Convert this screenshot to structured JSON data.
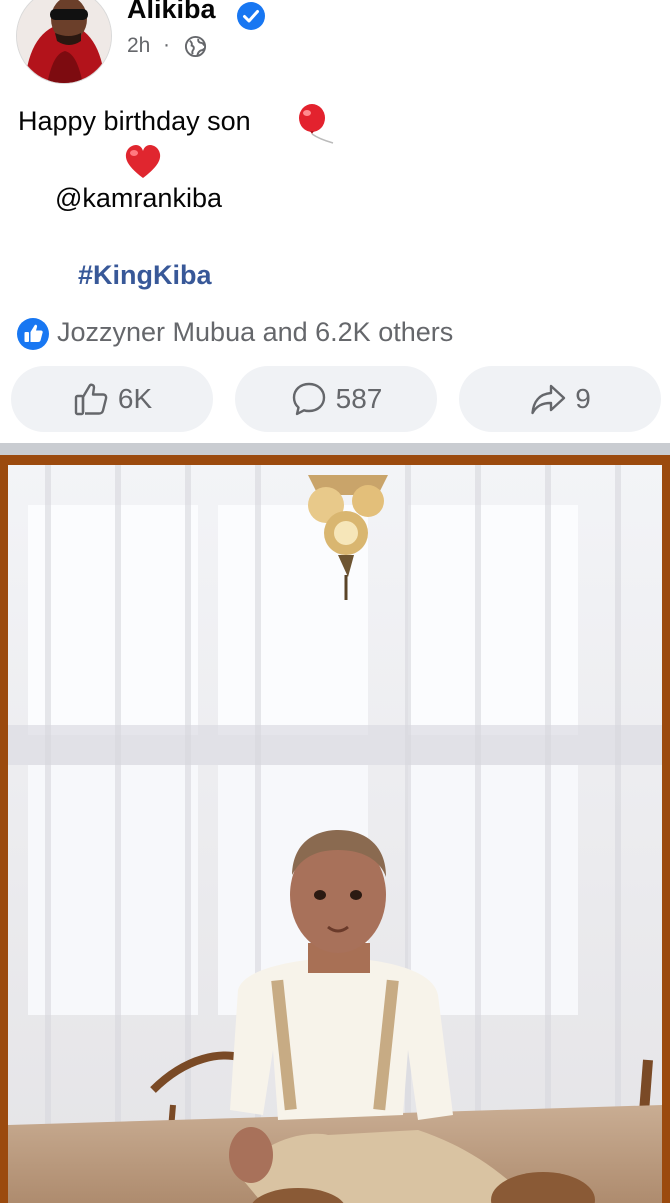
{
  "post": {
    "author": "Alikiba",
    "time": "2h",
    "separator": "·",
    "icons": {
      "verified": "verified-badge-icon",
      "audience": "globe-icon"
    },
    "text_line1": "Happy birthday son",
    "mention": "@kamrankiba",
    "hashtag": "#KingKiba",
    "emojis": [
      "balloon",
      "red-heart"
    ]
  },
  "reactions": {
    "summary": "Jozzyner Mubua and 6.2K others",
    "like_label": "6K",
    "comment_label": "587",
    "share_label": "9"
  },
  "colors": {
    "link": "#385898",
    "secondary_text": "#65676b",
    "fb_blue": "#1877f2",
    "button_bg": "#f0f2f5",
    "photo_frame": "#9b4a0e"
  }
}
